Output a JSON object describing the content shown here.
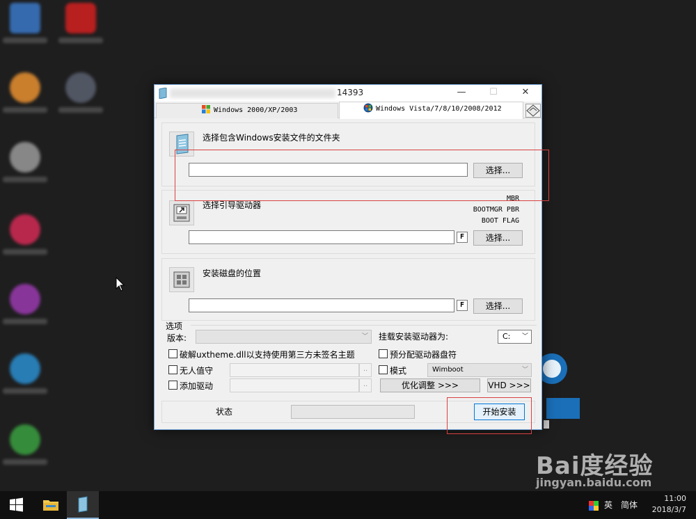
{
  "dialog": {
    "title_suffix": "14393",
    "window_controls": {
      "minimize": "—",
      "maximize": "☐",
      "close": "✕"
    },
    "tabs": [
      {
        "label": "Windows 2000/XP/2003",
        "active": false
      },
      {
        "label": "Windows Vista/7/8/10/2008/2012",
        "active": true
      }
    ],
    "section1": {
      "label": "选择包含Windows安装文件的文件夹",
      "path_value": "",
      "select_button": "选择..."
    },
    "section2": {
      "label": "选择引导驱动器",
      "info": [
        "MBR",
        "BOOTMGR PBR",
        "BOOT FLAG"
      ],
      "path_value": "",
      "f_button": "F",
      "select_button": "选择..."
    },
    "section3": {
      "label": "安装磁盘的位置",
      "path_value": "",
      "f_button": "F",
      "select_button": "选择..."
    },
    "options": {
      "title": "选项",
      "edition_label": "版本:",
      "edition_value": "",
      "mount_label": "挂载安装驱动器为:",
      "mount_value": "C:",
      "crack_uxtheme": "破解uxtheme.dll以支持使用第三方未签名主题",
      "preassign": "预分配驱动器盘符",
      "unattended": "无人值守",
      "mode_label": "模式",
      "mode_value": "Wimboot",
      "add_driver": "添加驱动",
      "ellipsis": "..",
      "tweak_button": "优化调整 >>>",
      "vhd_button": "VHD >>>"
    },
    "status": {
      "label": "状态",
      "progress": 0
    },
    "install_button": "开始安装"
  },
  "taskbar": {
    "ime_lang": "英",
    "ime_mode": "简体",
    "time": "11:00",
    "date": "2018/3/7"
  },
  "watermark": {
    "logo": "Bai度经验",
    "url": "jingyan.baidu.com"
  }
}
